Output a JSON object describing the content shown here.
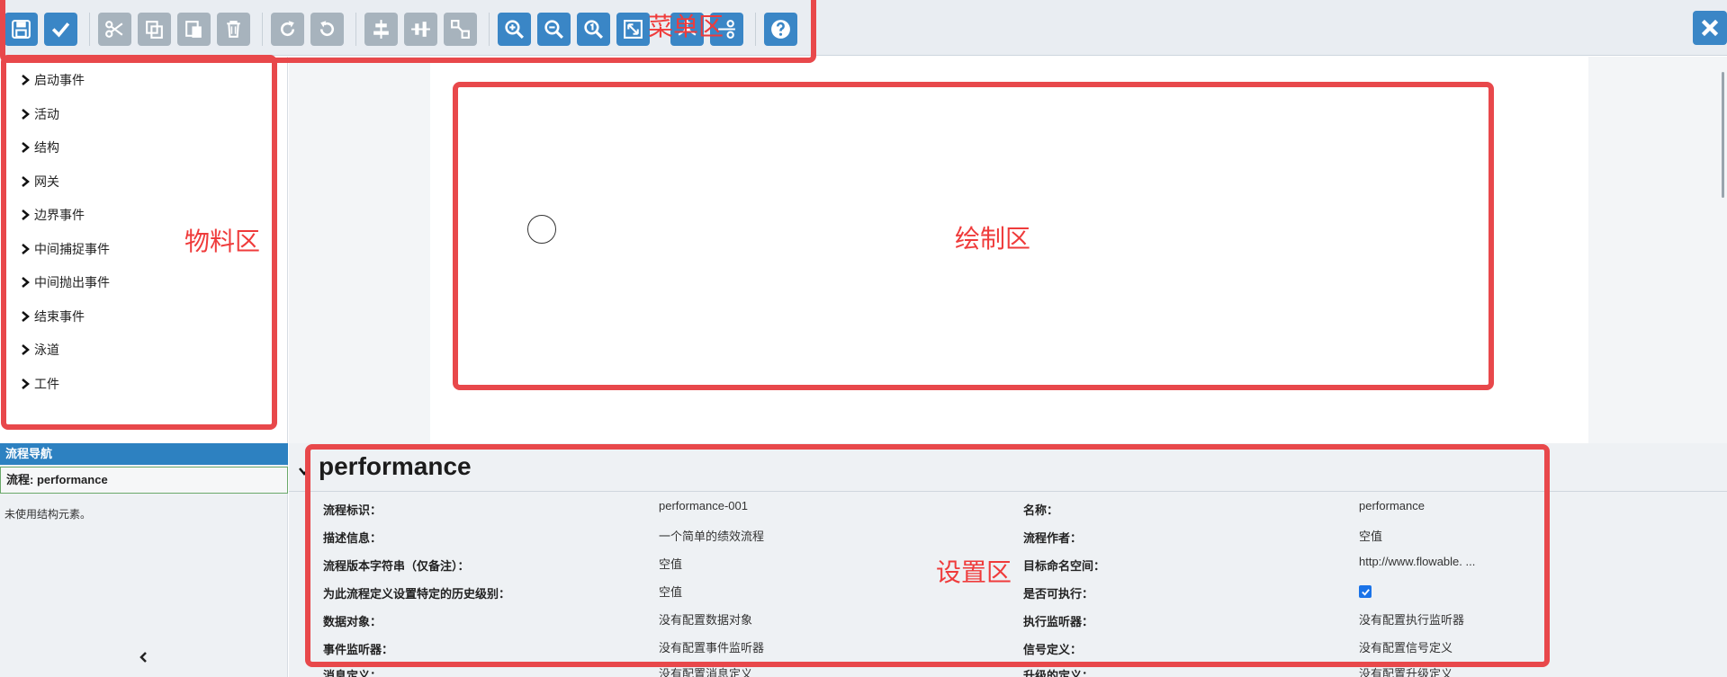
{
  "toolbar": {
    "buttons": [
      "save-icon",
      "checkmark-icon",
      "cut-icon",
      "copy-icon",
      "paste-icon",
      "delete-icon",
      "redo-icon",
      "undo-icon",
      "align-horizontal-icon",
      "align-vertical-icon",
      "same-size-icon",
      "zoom-in-icon",
      "zoom-out-icon",
      "zoom-actual-icon",
      "zoom-fit-icon",
      "bendpoint-add-icon",
      "bendpoint-remove-icon",
      "help-icon"
    ],
    "close_icon": "close-icon"
  },
  "palette": {
    "items": [
      "启动事件",
      "活动",
      "结构",
      "网关",
      "边界事件",
      "中间捕捉事件",
      "中间抛出事件",
      "结束事件",
      "泳道",
      "工件"
    ]
  },
  "navigator": {
    "header": "流程导航",
    "current": "流程: performance",
    "empty": "未使用结构元素。"
  },
  "properties": {
    "title": "performance",
    "rows": [
      {
        "label1": "流程标识：",
        "value1": "performance-001",
        "label2": "名称：",
        "value2": "performance"
      },
      {
        "label1": "描述信息：",
        "value1": "一个简单的绩效流程",
        "label2": "流程作者：",
        "value2": "空值"
      },
      {
        "label1": "流程版本字符串（仅备注）：",
        "value1": "空值",
        "label2": "目标命名空间：",
        "value2": "http://www.flowable. ..."
      },
      {
        "label1": "为此流程定义设置特定的历史级别：",
        "value1": "空值",
        "label2": "是否可执行：",
        "value2": ""
      },
      {
        "label1": "数据对象：",
        "value1": "没有配置数据对象",
        "label2": "执行监听器：",
        "value2": "没有配置执行监听器"
      },
      {
        "label1": "事件监听器：",
        "value1": "没有配置事件监听器",
        "label2": "信号定义：",
        "value2": "没有配置信号定义"
      },
      {
        "label1": "消息定义：",
        "value1": "没有配置消息定义",
        "label2": "升级的定义：",
        "value2": "没有配置升级定义"
      }
    ],
    "executable": true
  },
  "annotations": {
    "menu": "菜单区",
    "material": "物料区",
    "drawing": "绘制区",
    "settings": "设置区"
  },
  "colors": {
    "accent": "#3a86c6",
    "annotation": "#e8484b",
    "nav_header": "#2d81c1"
  }
}
